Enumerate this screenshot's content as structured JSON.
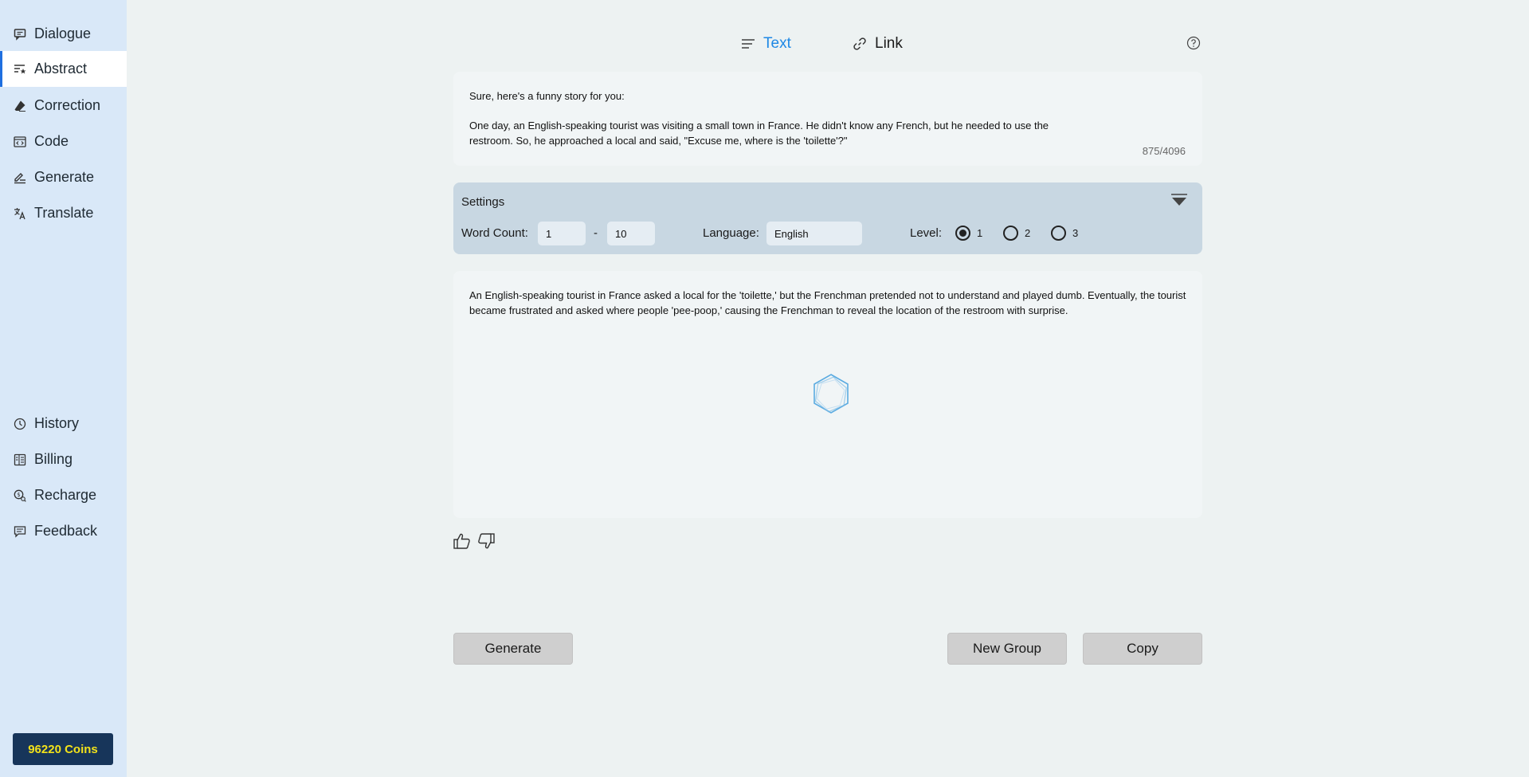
{
  "sidebar": {
    "items": [
      {
        "label": "Dialogue",
        "icon": "chat-icon"
      },
      {
        "label": "Abstract",
        "icon": "abstract-icon"
      },
      {
        "label": "Correction",
        "icon": "eraser-icon"
      },
      {
        "label": "Code",
        "icon": "code-icon"
      },
      {
        "label": "Generate",
        "icon": "pen-lines-icon"
      },
      {
        "label": "Translate",
        "icon": "translate-icon"
      }
    ],
    "bottom_items": [
      {
        "label": "History",
        "icon": "clock-icon"
      },
      {
        "label": "Billing",
        "icon": "bill-icon"
      },
      {
        "label": "Recharge",
        "icon": "coin-search-icon"
      },
      {
        "label": "Feedback",
        "icon": "message-icon"
      }
    ],
    "active": "Abstract",
    "coins": "96220 Coins"
  },
  "tabs": {
    "text_label": "Text",
    "link_label": "Link",
    "active": "Text"
  },
  "input": {
    "text": "Sure, here's a funny story for you:\n\nOne day, an English-speaking tourist was visiting a small town in France. He didn't know any French, but he needed to use the\nrestroom. So, he approached a local and said, \"Excuse me, where is the 'toilette'?\"",
    "counter": "875/4096"
  },
  "settings": {
    "title": "Settings",
    "word_count_label": "Word Count:",
    "word_count_min": "1",
    "dash": "-",
    "word_count_max": "10",
    "language_label": "Language:",
    "language_value": "English",
    "level_label": "Level:",
    "levels": [
      "1",
      "2",
      "3"
    ],
    "selected_level": "1"
  },
  "output": {
    "text": "An English-speaking tourist in France asked a local for the 'toilette,' but the Frenchman pretended not to understand and played dumb. Eventually, the tourist became frustrated and asked where people 'pee-poop,' causing the Frenchman to reveal the location of the restroom with surprise."
  },
  "buttons": {
    "generate": "Generate",
    "new_group": "New Group",
    "copy": "Copy"
  },
  "colors": {
    "accent": "#1e88e5",
    "sidebar_bg": "#d9e8f8",
    "coins_bg": "#17355a",
    "coins_text": "#f2e21a"
  }
}
